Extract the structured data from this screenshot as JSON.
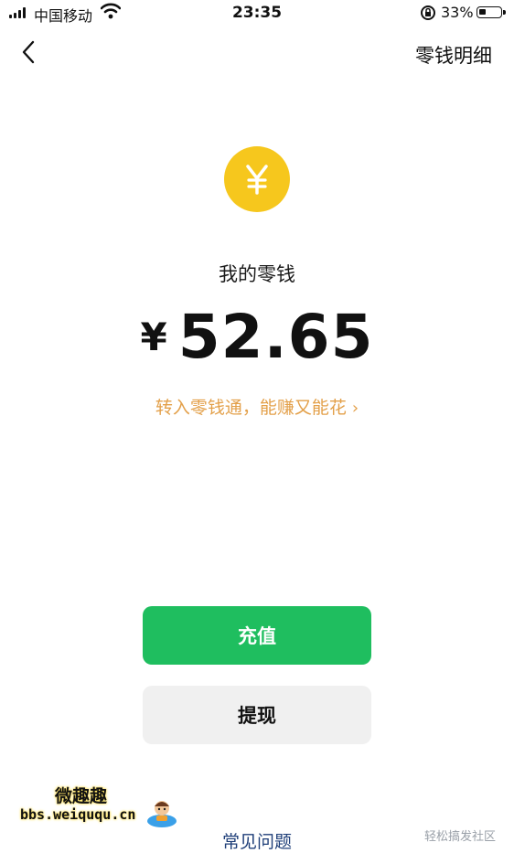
{
  "status_bar": {
    "carrier": "中国移动",
    "time": "23:35",
    "battery_percent": "33%",
    "battery_level": 0.33,
    "icons": [
      "signal-icon",
      "wifi-icon",
      "rotation-lock-icon",
      "battery-icon"
    ]
  },
  "nav": {
    "back_icon": "chevron-left-icon",
    "right_link": "零钱明细"
  },
  "wallet": {
    "icon": "yen-coin-icon",
    "icon_color": "#f6c71d",
    "icon_glyph": "¥",
    "label": "我的零钱",
    "currency": "¥",
    "balance": "52.65",
    "promo_text": "转入零钱通，能赚又能花",
    "promo_chevron": "›",
    "promo_color": "#e3a04a"
  },
  "actions": {
    "recharge_label": "充值",
    "withdraw_label": "提现",
    "primary_color": "#1fbe5f"
  },
  "footer": {
    "faq_label": "常见问题"
  },
  "watermarks": {
    "left_title": "微趣趣",
    "left_url": "bbs.weiququ.cn",
    "right_text": "轻松搞发社区"
  }
}
